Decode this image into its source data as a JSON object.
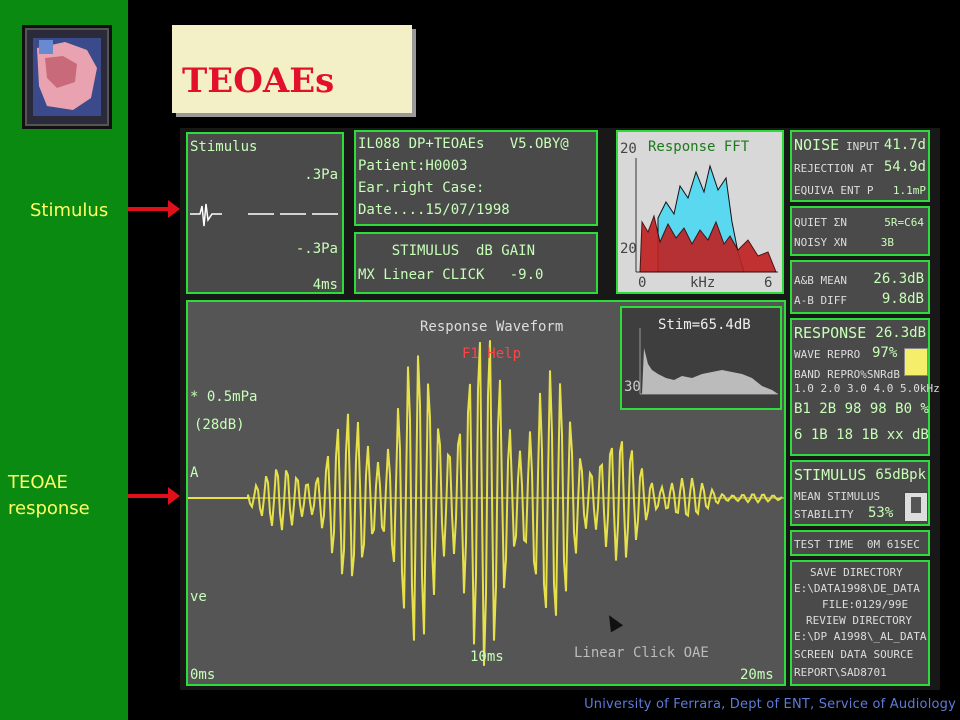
{
  "title": "TEOAEs",
  "side_labels": {
    "stimulus": "Stimulus",
    "teoae_line1": "TEOAE",
    "teoae_line2": "response"
  },
  "stimulus_panel": {
    "title": "Stimulus",
    "top_value": ".3Pa",
    "bottom_value": "-.3Pa",
    "time": "4ms"
  },
  "info_panel": {
    "line1": "IL088 DP+TEOAEs   V5.OBY@",
    "line2": "Patient:H0003",
    "line3": "Ear.right Case:",
    "line4": "Date....15/07/1998"
  },
  "gain_panel": {
    "header": "    STIMULUS  dB GAIN",
    "row": "MX Linear CLICK   -9.0"
  },
  "fft_panel": {
    "title": "Response FFT",
    "y_top": "20",
    "y_bottom": "20",
    "x_left": "0",
    "x_label": "kHz",
    "x_right": "6"
  },
  "noise_panel": {
    "heading": "NOISE",
    "rows": [
      [
        "INPUT",
        "41.7d"
      ],
      [
        "REJECTION AT",
        "54.9d"
      ],
      [
        "EQUIVA ENT P",
        "1.1mP"
      ]
    ]
  },
  "quiet_panel": {
    "rows": [
      [
        "QUIET ΣN",
        "5R=C64"
      ],
      [
        "NOISY XN",
        "3B"
      ]
    ]
  },
  "repro_panel": {
    "rows": [
      [
        "A&B MEAN",
        "26.3dB"
      ],
      [
        "A-B DIFF",
        "9.8dB"
      ]
    ]
  },
  "response_panel": {
    "heading": "RESPONSE",
    "value": "26.3dB",
    "wave_repro": "WAVE REPRO",
    "wave_pct": "97%",
    "band_label": "BAND REPRO%SNRdB",
    "band_freqs": "1.0 2.0 3.0 4.0 5.0kHz",
    "band_row1": "B1 2B 98 98 B0 %",
    "band_row2": "6 1B 18 1B xx dB"
  },
  "stimulus_summary": {
    "heading": "STIMULUS",
    "level": "65dBpk",
    "line1": "MEAN STIMULUS",
    "line2": "STABILITY",
    "stability": "53%"
  },
  "test_time": "TEST TIME  0M 61SEC",
  "directory_panel": {
    "lines": [
      "SAVE DIRECTORY",
      "E:\\DATA1998\\DE_DATA",
      "FILE:0129/99E",
      "REVIEW DIRECTORY",
      "E:\\DP A1998\\_AL_DATA",
      "SCREEN DATA SOURCE",
      "REPORT\\SAD8701"
    ]
  },
  "waveform_panel": {
    "title": "Response Waveform",
    "help": "F1 Help",
    "scale": "* 0.5mPa",
    "scale_db": "(28dB)",
    "ch_a": "A",
    "ve": "ve",
    "t0": "0ms",
    "t10": "10ms",
    "t20": "20ms",
    "mode": "Linear Click OAE"
  },
  "stim_spectrum": {
    "label": "Stim=65.4dB",
    "y": "30"
  },
  "footer": "University of Ferrara, Dept of ENT, Service of Audiology",
  "colors": {
    "sidebar": "#0a8a10",
    "panel_border": "#2ddb3a",
    "waveform": "#e6e04a",
    "fft_a": "#5ad8f0",
    "fft_b": "#c02020",
    "title": "#e3102a"
  }
}
